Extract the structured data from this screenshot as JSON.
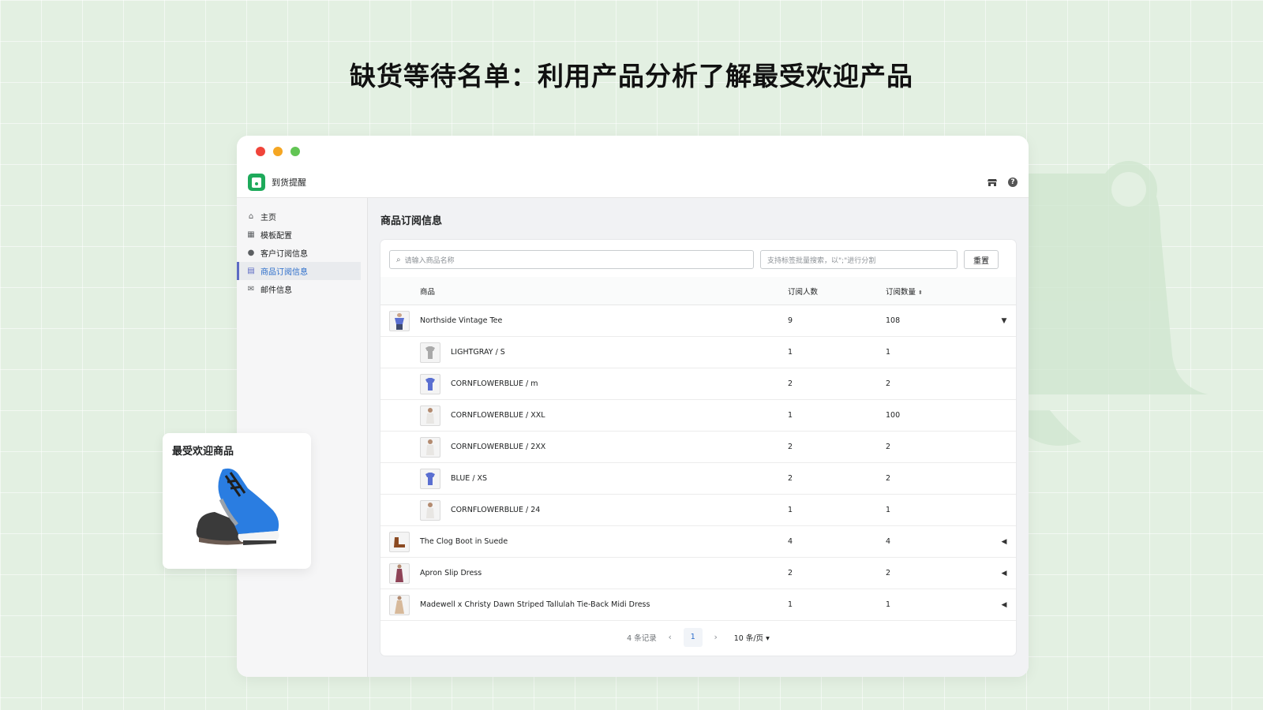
{
  "headline": "缺货等待名单：利用产品分析了解最受欢迎产品",
  "app": {
    "name": "到货提醒"
  },
  "sidebar": {
    "items": [
      {
        "label": "主页",
        "icon": "home-icon"
      },
      {
        "label": "模板配置",
        "icon": "template-icon"
      },
      {
        "label": "客户订阅信息",
        "icon": "customer-icon"
      },
      {
        "label": "商品订阅信息",
        "icon": "product-icon",
        "active": true
      },
      {
        "label": "邮件信息",
        "icon": "mail-icon"
      }
    ]
  },
  "main": {
    "title": "商品订阅信息",
    "search_placeholder": "请输入商品名称",
    "tag_search_placeholder": "支持标签批量搜索，以\";\"进行分割",
    "reset_label": "重置",
    "columns": {
      "product": "商品",
      "subscribers": "订阅人数",
      "quantity": "订阅数量"
    },
    "rows": [
      {
        "name": "Northside Vintage Tee",
        "subscribers": "9",
        "quantity": "108",
        "expanded": true
      },
      {
        "name": "LIGHTGRAY / S",
        "subscribers": "1",
        "quantity": "1",
        "variant": true
      },
      {
        "name": "CORNFLOWERBLUE / m",
        "subscribers": "2",
        "quantity": "2",
        "variant": true
      },
      {
        "name": "CORNFLOWERBLUE / XXL",
        "subscribers": "1",
        "quantity": "100",
        "variant": true
      },
      {
        "name": "CORNFLOWERBLUE / 2XX",
        "subscribers": "2",
        "quantity": "2",
        "variant": true
      },
      {
        "name": "BLUE / XS",
        "subscribers": "2",
        "quantity": "2",
        "variant": true
      },
      {
        "name": "CORNFLOWERBLUE / 24",
        "subscribers": "1",
        "quantity": "1",
        "variant": true
      },
      {
        "name": "The Clog Boot in Suede",
        "subscribers": "4",
        "quantity": "4",
        "expanded": false
      },
      {
        "name": "Apron Slip Dress",
        "subscribers": "2",
        "quantity": "2",
        "expanded": false
      },
      {
        "name": "Madewell x Christy Dawn Striped Tallulah Tie-Back Midi Dress",
        "subscribers": "1",
        "quantity": "1",
        "expanded": false
      }
    ],
    "pagination": {
      "total": "4 条记录",
      "current_page": "1",
      "page_size": "10 条/页"
    }
  },
  "popular_card": {
    "title": "最受欢迎商品"
  },
  "colors": {
    "background": "#e3f0e2",
    "accent": "#2c6ecb",
    "brand": "#1eaa5b"
  }
}
